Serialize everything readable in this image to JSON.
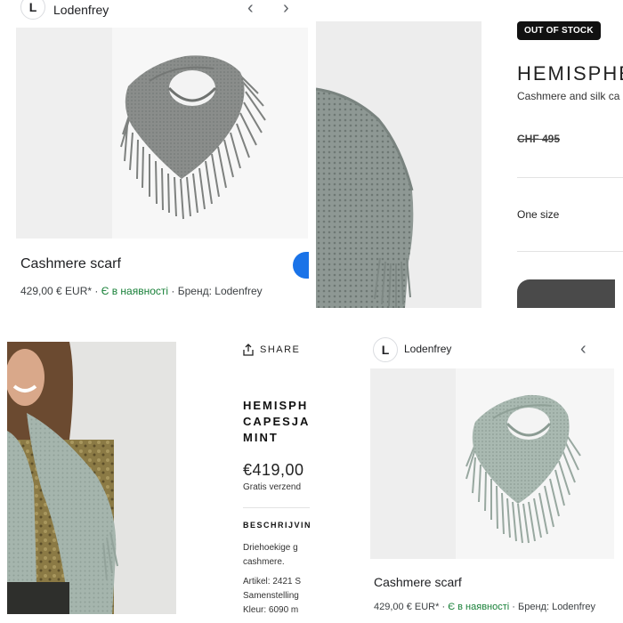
{
  "top_left": {
    "brand_initial": "L",
    "brand_name": "Lodenfrey",
    "product_title": "Cashmere scarf",
    "price": "429,00 € EUR*",
    "separator": "·",
    "stock": "Є в наявності",
    "brand_line": "Бренд: Lodenfrey"
  },
  "top_right": {
    "badge": "OUT OF STOCK",
    "title": "HEMISPHE",
    "subtitle": "Cashmere and silk ca",
    "old_price": "CHF 495",
    "size": "One size"
  },
  "bottom_left": {
    "share_label": "SHARE",
    "title_lines": [
      "HEMISPH",
      "CAPESJA",
      "MINT"
    ],
    "price": "€419,00",
    "shipping": "Gratis verzend",
    "description_heading": "BESCHRIJVIN",
    "description_lines": [
      "Driehoekige g",
      "cashmere."
    ],
    "spec_lines": [
      "Artikel: 2421 S",
      "Samenstelling",
      "Kleur: 6090 m"
    ]
  },
  "bottom_right": {
    "brand_initial": "L",
    "brand_name": "Lodenfrey",
    "product_title": "Cashmere scarf",
    "price": "429,00 € EUR*",
    "separator": "·",
    "stock": "Є в наявності",
    "brand_line": "Бренд: Lodenfrey"
  },
  "colors": {
    "scarf_grey": "#8a8d8b",
    "scarf_mint": "#a9b9b1",
    "stock_green": "#188038",
    "accent_blue": "#1a73e8",
    "badge_black": "#111111"
  }
}
